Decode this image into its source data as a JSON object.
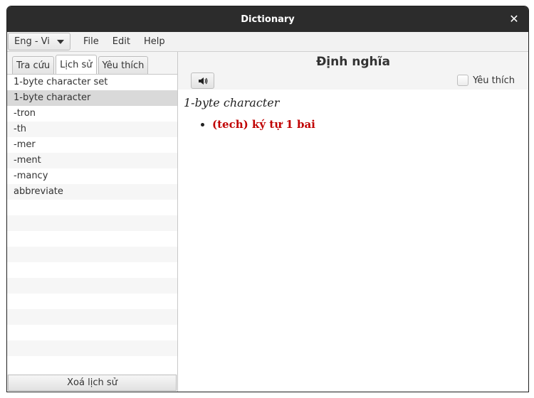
{
  "window": {
    "title": "Dictionary"
  },
  "menubar": {
    "language": "Eng - Vi",
    "items": [
      "File",
      "Edit",
      "Help"
    ]
  },
  "left": {
    "tabs": [
      {
        "label": "Tra cứu",
        "active": false
      },
      {
        "label": "Lịch sử",
        "active": true
      },
      {
        "label": "Yêu thích",
        "active": false
      }
    ],
    "history": [
      "1-byte character set",
      "1-byte character",
      "-tron",
      "-th",
      "-mer",
      "-ment",
      "-mancy",
      "abbreviate"
    ],
    "selected_index": 1,
    "clear_label": "Xoá lịch sử"
  },
  "right": {
    "title": "Định nghĩa",
    "favorite_label": "Yêu thích",
    "word": "1-byte character",
    "meanings": [
      "(tech) ký tự 1 bai"
    ]
  },
  "icons": {
    "close": "close-icon",
    "speaker": "speaker-icon",
    "dropdown": "chevron-down-icon"
  }
}
